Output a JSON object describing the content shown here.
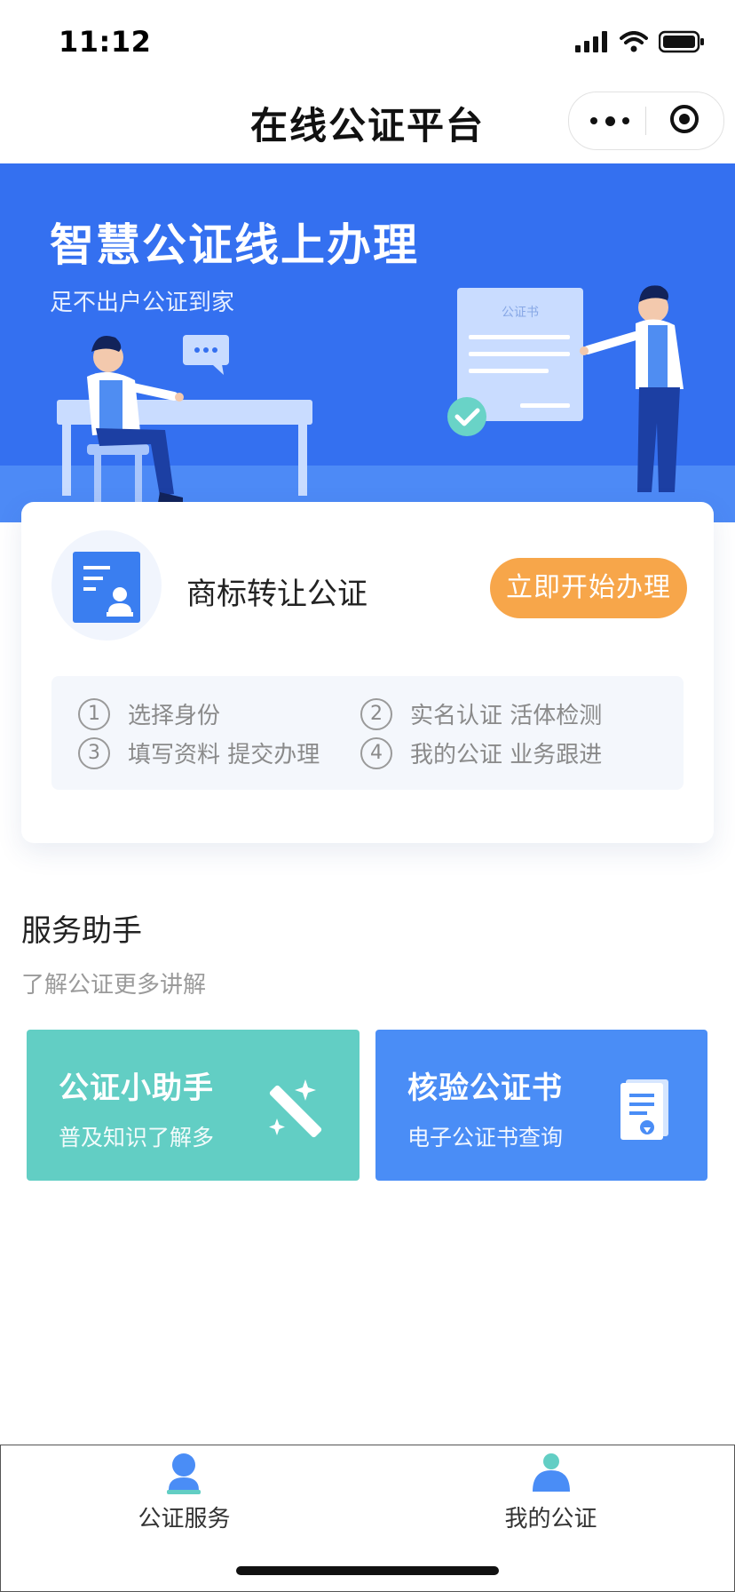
{
  "status_bar": {
    "time": "11:12"
  },
  "nav": {
    "title": "在线公证平台",
    "more_icon": "more-dots-icon",
    "close_icon": "target-circle-icon"
  },
  "banner": {
    "title": "智慧公证线上办理",
    "subtitle": "足不出户公证到家",
    "document_label": "公证书"
  },
  "card": {
    "title": "商标转让公证",
    "button_label": "立即开始办理",
    "steps": [
      {
        "num": "1",
        "text": "选择身份"
      },
      {
        "num": "2",
        "text": "实名认证 活体检测"
      },
      {
        "num": "3",
        "text": "填写资料 提交办理"
      },
      {
        "num": "4",
        "text": "我的公证 业务跟进"
      }
    ]
  },
  "services": {
    "title": "服务助手",
    "subtitle": "了解公证更多讲解",
    "tiles": [
      {
        "title": "公证小助手",
        "subtitle": "普及知识了解多",
        "icon": "magic-wand-icon",
        "color": "#62cec4"
      },
      {
        "title": "核验公证书",
        "subtitle": "电子公证书查询",
        "icon": "certificate-icon",
        "color": "#4a8df6"
      }
    ]
  },
  "tab_bar": {
    "tabs": [
      {
        "label": "公证服务",
        "icon": "notary-service-icon"
      },
      {
        "label": "我的公证",
        "icon": "user-profile-icon"
      }
    ]
  },
  "colors": {
    "brand_blue": "#3470f0",
    "accent_orange": "#f7a64a",
    "teal": "#62cec4"
  }
}
